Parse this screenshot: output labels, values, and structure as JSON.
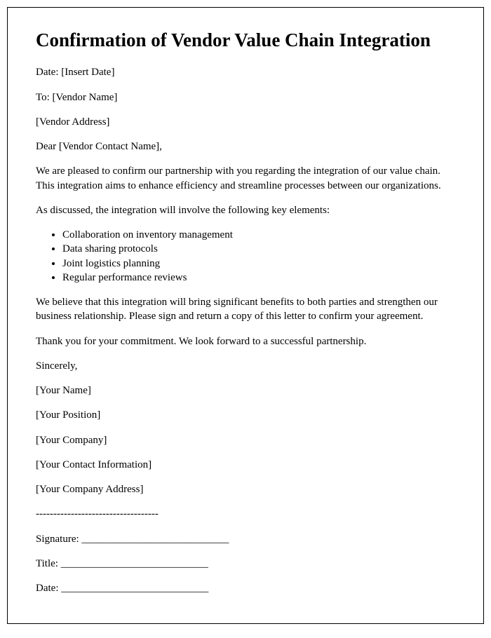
{
  "title": "Confirmation of Vendor Value Chain Integration",
  "date_line": "Date: [Insert Date]",
  "to_line": "To: [Vendor Name]",
  "address_line": "[Vendor Address]",
  "salutation": "Dear [Vendor Contact Name],",
  "paragraph1": "We are pleased to confirm our partnership with you regarding the integration of our value chain. This integration aims to enhance efficiency and streamline processes between our organizations.",
  "paragraph2": "As discussed, the integration will involve the following key elements:",
  "bullets": [
    "Collaboration on inventory management",
    "Data sharing protocols",
    "Joint logistics planning",
    "Regular performance reviews"
  ],
  "paragraph3": "We believe that this integration will bring significant benefits to both parties and strengthen our business relationship. Please sign and return a copy of this letter to confirm your agreement.",
  "paragraph4": "Thank you for your commitment. We look forward to a successful partnership.",
  "closing": "Sincerely,",
  "sender_name": "[Your Name]",
  "sender_position": "[Your Position]",
  "sender_company": "[Your Company]",
  "sender_contact": "[Your Contact Information]",
  "sender_address": "[Your Company Address]",
  "divider": "-----------------------------------",
  "signature_line": "Signature: ____________________________",
  "title_line": "Title: ____________________________",
  "sig_date_line": "Date: ____________________________"
}
